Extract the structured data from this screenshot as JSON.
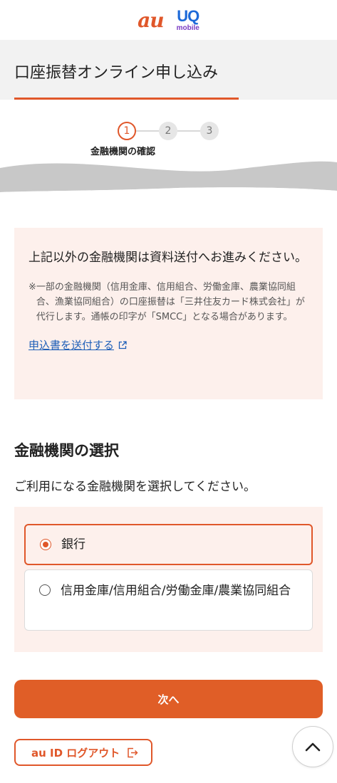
{
  "header": {
    "logo_au": "au",
    "logo_uq": "UQ",
    "logo_mobile": "mobile"
  },
  "page": {
    "title": "口座振替オンライン申し込み"
  },
  "stepper": {
    "steps": [
      "1",
      "2",
      "3"
    ],
    "current_step": 1,
    "current_label": "金融機関の確認"
  },
  "notice": {
    "main_text": "上記以外の金融機関は資料送付へお進みください。",
    "note_mark": "※",
    "note_text": "一部の金融機関（信用金庫、信用組合、労働金庫、農業協同組合、漁業協同組合）の口座振替は「三井住友カード株式会社」が代行します。通帳の印字が「SMCC」となる場合があります。",
    "link_text": "申込書を送付する"
  },
  "selection": {
    "title": "金融機関の選択",
    "description": "ご利用になる金融機関を選択してください。",
    "options": [
      {
        "label": "銀行",
        "selected": true
      },
      {
        "label": "信用金庫/信用組合/労働金庫/農業協同組合",
        "selected": false
      }
    ]
  },
  "actions": {
    "next_label": "次へ",
    "logout_label": "au ID ログアウト"
  },
  "colors": {
    "accent": "#e0572a",
    "notice_bg": "#fdf0ec",
    "link": "#1e5fb8"
  },
  "icons": {
    "external_link": "external-link-icon",
    "logout": "logout-icon",
    "scroll_top": "chevron-up-icon"
  }
}
